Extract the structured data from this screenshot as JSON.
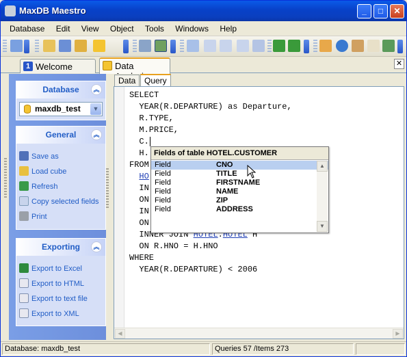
{
  "window": {
    "title": "MaxDB Maestro"
  },
  "menu": [
    "Database",
    "Edit",
    "View",
    "Object",
    "Tools",
    "Windows",
    "Help"
  ],
  "tabs": [
    {
      "num": "1",
      "label": "Welcome page"
    },
    {
      "label": "Data Analysis"
    }
  ],
  "left": {
    "database": {
      "header": "Database",
      "selected_db": "maxdb_test"
    },
    "general": {
      "header": "General",
      "items": [
        "Save as",
        "Load cube",
        "Refresh",
        "Copy selected fields",
        "Print"
      ]
    },
    "exporting": {
      "header": "Exporting",
      "items": [
        "Export to Excel",
        "Export to HTML",
        "Export to text file",
        "Export to XML"
      ]
    }
  },
  "subtabs": [
    "Data",
    "Query"
  ],
  "code": {
    "l1": "SELECT",
    "l2": "  YEAR(R.DEPARTURE) as Departure,",
    "l3": "  R.TYPE,",
    "l4": "  M.PRICE,",
    "l5": "  C.",
    "l6": "  H.",
    "l7": "FROM",
    "l8a": "  ",
    "l8b": "HO",
    "l9": "  IN",
    "l10": "  ON",
    "l11": "  IN",
    "l12": "  ON",
    "l13a": "  INNER JOIN ",
    "l13b": "HOTEL",
    "l13c": ".",
    "l13d": "HOTEL",
    "l13e": " H",
    "l14": "  ON R.HNO = H.HNO",
    "l15": "WHERE",
    "l16": "  YEAR(R.DEPARTURE) < 2006"
  },
  "popup": {
    "header": "Fields of table HOTEL.CUSTOMER",
    "rows": [
      {
        "kind": "Field",
        "name": "CNO"
      },
      {
        "kind": "Field",
        "name": "TITLE"
      },
      {
        "kind": "Field",
        "name": "FIRSTNAME"
      },
      {
        "kind": "Field",
        "name": "NAME"
      },
      {
        "kind": "Field",
        "name": "ZIP"
      },
      {
        "kind": "Field",
        "name": "ADDRESS"
      }
    ]
  },
  "status": {
    "database": "Database: maxdb_test",
    "counts": "Queries 57 /Items 273"
  }
}
